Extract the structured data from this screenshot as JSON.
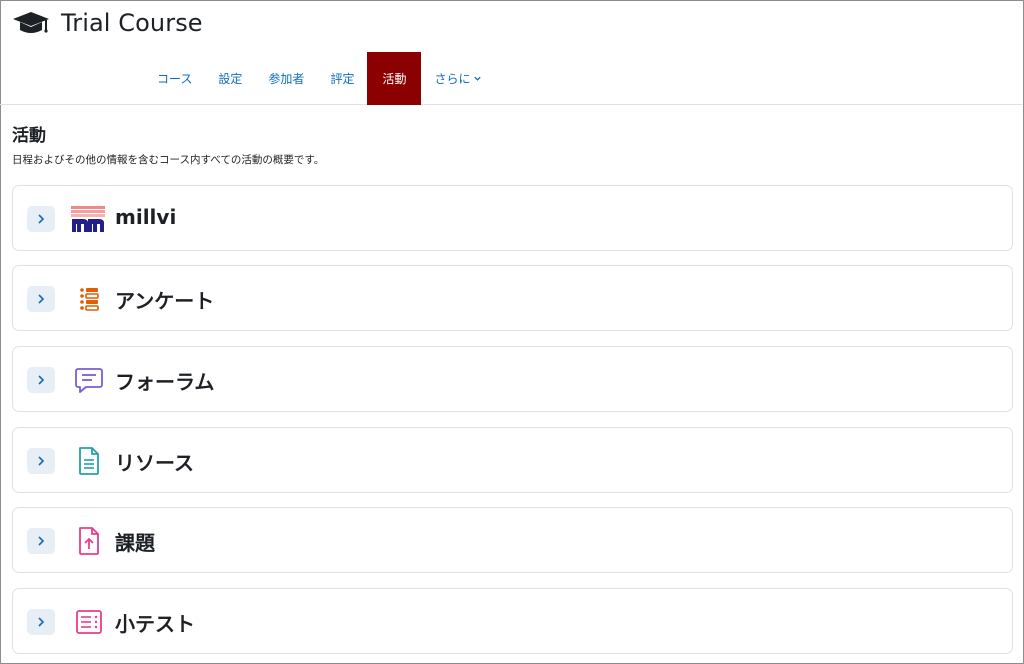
{
  "course": {
    "title": "Trial Course"
  },
  "nav": {
    "tabs": [
      {
        "label": "コース"
      },
      {
        "label": "設定"
      },
      {
        "label": "参加者"
      },
      {
        "label": "評定"
      },
      {
        "label": "活動",
        "active": true
      },
      {
        "label": "さらに",
        "has_dropdown": true
      }
    ]
  },
  "page": {
    "heading": "活動",
    "description": "日程およびその他の情報を含むコース内すべての活動の概要です。"
  },
  "activities": [
    {
      "name": "millvi",
      "icon": "millvi-logo-icon",
      "color": "#221e8a"
    },
    {
      "name": "アンケート",
      "icon": "survey-icon",
      "color": "#e65c00"
    },
    {
      "name": "フォーラム",
      "icon": "forum-icon",
      "color": "#7a5cd6"
    },
    {
      "name": "リソース",
      "icon": "file-icon",
      "color": "#23a2a8"
    },
    {
      "name": "課題",
      "icon": "assignment-upload-icon",
      "color": "#e83e8c"
    },
    {
      "name": "小テスト",
      "icon": "quiz-icon",
      "color": "#e83e8c"
    }
  ],
  "colors": {
    "active_tab": "#8b0000",
    "link": "#0f6cbf",
    "expander_bg": "#e8eef6"
  }
}
